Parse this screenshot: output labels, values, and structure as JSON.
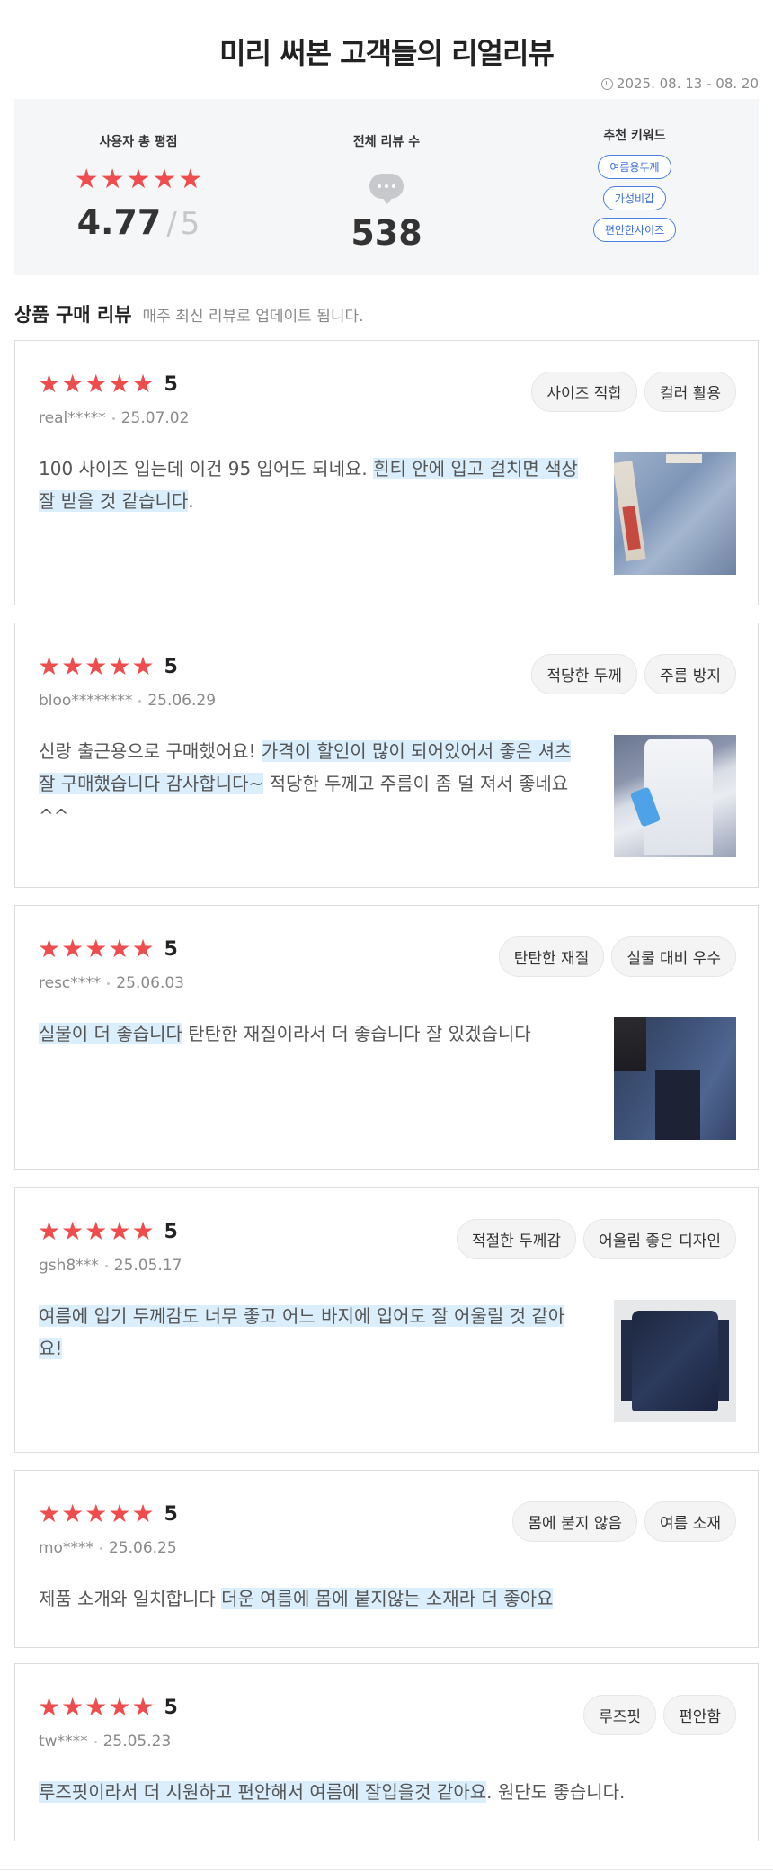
{
  "header": {
    "title": "미리 써본 고객들의 리얼리뷰",
    "period": "2025. 08. 13 - 08. 20"
  },
  "summary": {
    "rating_label": "사용자 총 평점",
    "rating": "4.77",
    "rating_slash": "/",
    "rating_max": "5",
    "stars_filled": 5,
    "count_label": "전체 리뷰 수",
    "count": "538",
    "keywords_label": "추천 키워드",
    "keywords": [
      "여름용두께",
      "가성비갑",
      "편안한사이즈"
    ]
  },
  "section": {
    "title": "상품 구매 리뷰",
    "subtitle": "매주 최신 리뷰로 업데이트 됩니다."
  },
  "colors": {
    "star": "#ef4d4d",
    "highlight": "#dbeefc",
    "keyword": "#3b6fd4"
  },
  "reviews": [
    {
      "score": "5",
      "user": "real*****",
      "date": "25.07.02",
      "tags": [
        "사이즈 적합",
        "컬러 활용"
      ],
      "text_plain1": "100 사이즈 입는데 이건 95 입어도 되네요. ",
      "text_hl": "흰티 안에 입고 걸치면 색상 잘 받을 것 같습니다",
      "text_plain2": "."
    },
    {
      "score": "5",
      "user": "bloo********",
      "date": "25.06.29",
      "tags": [
        "적당한 두께",
        "주름 방지"
      ],
      "text_plain1": "신랑 출근용으로 구매했어요! ",
      "text_hl": "가격이 할인이 많이 되어있어서 좋은 셔츠 잘 구매했습니다 감사합니다~",
      "text_plain2": " 적당한 두께고 주름이 좀 덜 져서 좋네요^^"
    },
    {
      "score": "5",
      "user": "resc****",
      "date": "25.06.03",
      "tags": [
        "탄탄한 재질",
        "실물 대비 우수"
      ],
      "text_plain1": "",
      "text_hl": "실물이 더 좋습니다",
      "text_plain2": " 탄탄한 재질이라서 더 좋습니다 잘 있겠습니다"
    },
    {
      "score": "5",
      "user": "gsh8***",
      "date": "25.05.17",
      "tags": [
        "적절한 두께감",
        "어울림 좋은 디자인"
      ],
      "text_plain1": "",
      "text_hl": "여름에 입기 두께감도 너무 좋고 어느 바지에 입어도 잘 어울릴 것 같아요!",
      "text_plain2": ""
    },
    {
      "score": "5",
      "user": "mo****",
      "date": "25.06.25",
      "tags": [
        "몸에 붙지 않음",
        "여름 소재"
      ],
      "text_plain1": "제품 소개와 일치합니다 ",
      "text_hl": "더운 여름에 몸에 붙지않는 소재라 더 좋아요",
      "text_plain2": ""
    },
    {
      "score": "5",
      "user": "tw****",
      "date": "25.05.23",
      "tags": [
        "루즈핏",
        "편안함"
      ],
      "text_plain1": "",
      "text_hl": "루즈핏이라서 더 시원하고 편안해서 여름에 잘입을것 같아요",
      "text_plain2": ". 원단도 좋습니다."
    }
  ]
}
